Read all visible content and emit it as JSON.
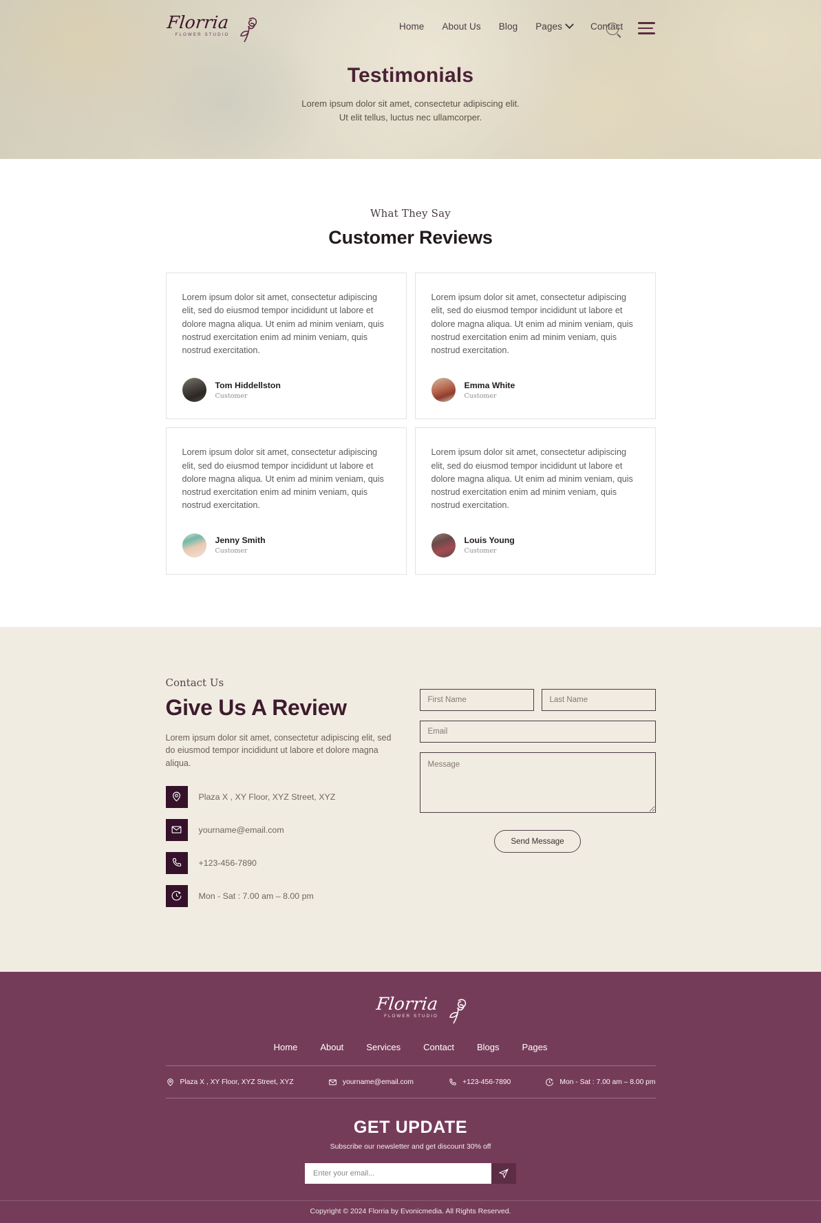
{
  "brand": {
    "name": "Florria",
    "tagline": "FLOWER STUDIO",
    "accent_purple": "#753c59",
    "accent_dark": "#35112a",
    "cream": "#f1ece2"
  },
  "nav": {
    "items": [
      {
        "label": "Home"
      },
      {
        "label": "About Us"
      },
      {
        "label": "Blog"
      },
      {
        "label": "Pages"
      },
      {
        "label": "Contact"
      }
    ],
    "search_icon": "search-icon",
    "menu_icon": "hamburger-menu-icon",
    "dropdown_icon": "chevron-down-icon"
  },
  "hero": {
    "title": "Testimonials",
    "subtitle_line1": "Lorem ipsum dolor sit amet, consectetur adipiscing elit.",
    "subtitle_line2": "Ut elit tellus, luctus nec ullamcorper."
  },
  "reviews": {
    "eyebrow": "What They Say",
    "title": "Customer Reviews",
    "body_text": "Lorem ipsum dolor sit amet, consectetur adipiscing elit, sed do eiusmod tempor incididunt ut labore et dolore magna aliqua. Ut enim ad minim veniam, quis nostrud exercitation enim ad minim veniam, quis nostrud exercitation.",
    "cards": [
      {
        "name": "Tom Hiddellston",
        "role": "Customer"
      },
      {
        "name": "Emma White",
        "role": "Customer"
      },
      {
        "name": "Jenny Smith",
        "role": "Customer"
      },
      {
        "name": "Louis Young",
        "role": "Customer"
      }
    ]
  },
  "contact": {
    "eyebrow": "Contact Us",
    "title": "Give Us A Review",
    "description": "Lorem ipsum dolor sit amet, consectetur adipiscing elit, sed do eiusmod tempor incididunt ut labore et dolore magna aliqua.",
    "info": [
      {
        "icon": "location-pin-icon",
        "text": "Plaza X , XY Floor, XYZ Street, XYZ"
      },
      {
        "icon": "envelope-icon",
        "text": "yourname@email.com"
      },
      {
        "icon": "phone-icon",
        "text": "+123-456-7890"
      },
      {
        "icon": "clock-24-icon",
        "text": "Mon - Sat : 7.00 am – 8.00 pm"
      }
    ],
    "form": {
      "first_name_placeholder": "First Name",
      "first_name_value": "",
      "last_name_placeholder": "Last Name",
      "last_name_value": "",
      "email_placeholder": "Email",
      "email_value": "",
      "message_placeholder": "Message",
      "message_value": "",
      "submit_label": "Send Message"
    }
  },
  "footer": {
    "nav": [
      {
        "label": "Home"
      },
      {
        "label": "About"
      },
      {
        "label": "Services"
      },
      {
        "label": "Contact"
      },
      {
        "label": "Blogs"
      },
      {
        "label": "Pages"
      }
    ],
    "contact": [
      {
        "icon": "location-pin-icon",
        "text": "Plaza X , XY Floor, XYZ Street, XYZ"
      },
      {
        "icon": "envelope-icon",
        "text": "yourname@email.com"
      },
      {
        "icon": "phone-icon",
        "text": "+123-456-7890"
      },
      {
        "icon": "clock-24-icon",
        "text": "Mon - Sat : 7.00 am – 8.00 pm"
      }
    ],
    "newsletter": {
      "title": "GET UPDATE",
      "subtitle": "Subscribe our newsletter and get discount 30% off",
      "placeholder": "Enter your email...",
      "value": "",
      "button_icon": "paper-plane-icon"
    },
    "copyright": "Copyright © 2024 Florria by Evonicmedia. All Rights Reserved."
  }
}
